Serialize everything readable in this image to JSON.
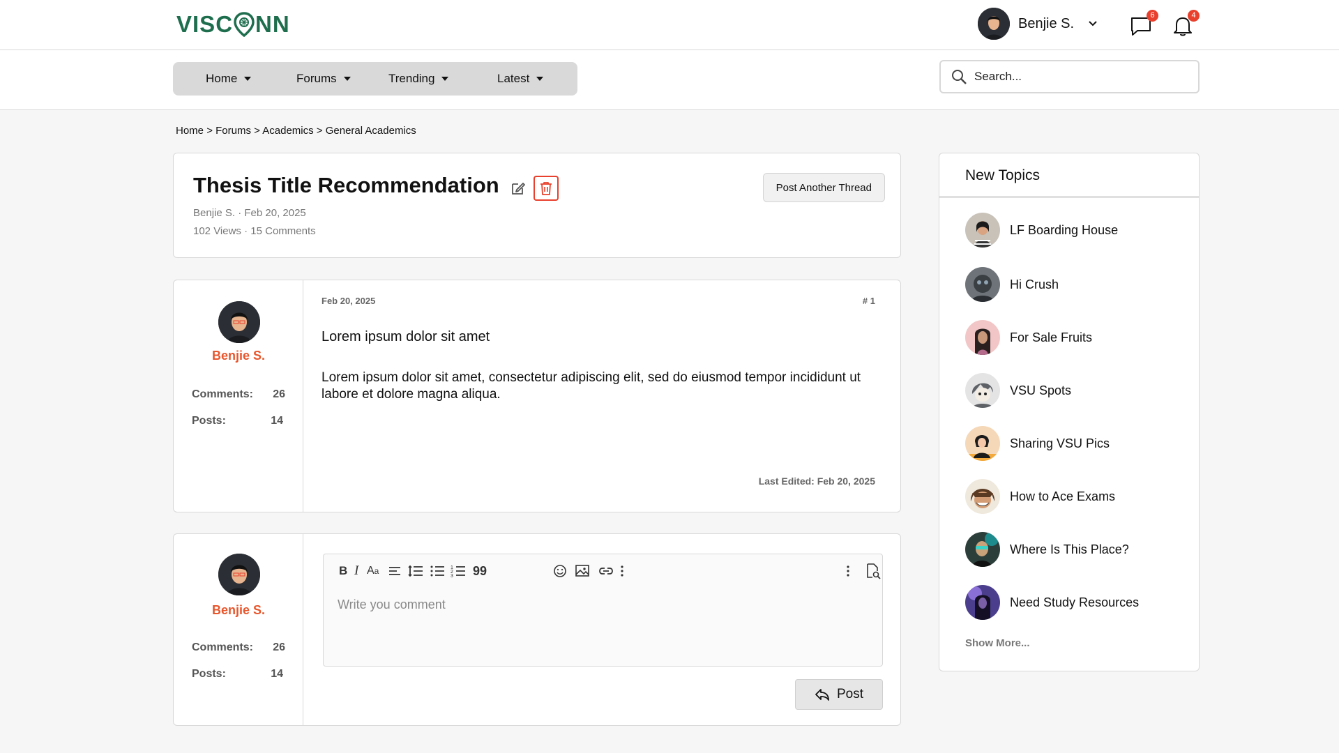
{
  "brand": {
    "logo_left": "VISC",
    "logo_right": "NN",
    "color": "#1e6e4e"
  },
  "header": {
    "user_name": "Benjie S.",
    "messages_count": "6",
    "notifications_count": "4"
  },
  "nav": {
    "items": [
      {
        "label": "Home"
      },
      {
        "label": "Forums"
      },
      {
        "label": "Trending"
      },
      {
        "label": "Latest"
      }
    ],
    "search_placeholder": "Search..."
  },
  "breadcrumb": {
    "items": [
      "Home",
      "Forums",
      "Academics",
      "General Academics"
    ],
    "separator": ">"
  },
  "thread": {
    "title": "Thesis Title Recommendation",
    "author_date": "Benjie S. · Feb 20, 2025",
    "stats": "102 Views · 15 Comments",
    "post_another_label": "Post Another Thread"
  },
  "post": {
    "author": "Benjie S.",
    "comments_label": "Comments:",
    "comments_value": "26",
    "posts_label": "Posts:",
    "posts_value": "14",
    "date": "Feb 20, 2025",
    "number": "# 1",
    "title": "Lorem ipsum dolor sit amet",
    "body": "Lorem ipsum dolor sit amet, consectetur adipiscing elit, sed do eiusmod tempor incididunt ut labore et dolore magna aliqua.",
    "last_edited": "Last Edited: Feb 20, 2025"
  },
  "reply": {
    "author": "Benjie S.",
    "comments_label": "Comments:",
    "comments_value": "26",
    "posts_label": "Posts:",
    "posts_value": "14",
    "comment_placeholder": "Write you comment",
    "post_label": "Post",
    "toolbar_icons": [
      "bold-icon",
      "italic-icon",
      "font-size-icon",
      "align-icon",
      "line-spacing-icon",
      "bullet-list-icon",
      "numbered-list-icon",
      "quote-icon",
      "emoji-icon",
      "image-icon",
      "link-icon",
      "more-icon",
      "more-vertical-icon",
      "preview-icon"
    ]
  },
  "sidebar": {
    "title": "New Topics",
    "topics": [
      {
        "label": "LF Boarding House",
        "color": "#c8c2b8"
      },
      {
        "label": "Hi Crush",
        "color": "#6d7378"
      },
      {
        "label": "For Sale Fruits",
        "color": "#f2c6c6"
      },
      {
        "label": "VSU Spots",
        "color": "#e4e4e4"
      },
      {
        "label": "Sharing VSU Pics",
        "color": "#f5d8b8"
      },
      {
        "label": "How to Ace Exams",
        "color": "#efe8dc"
      },
      {
        "label": "Where Is This Place?",
        "color": "#2c3e3a"
      },
      {
        "label": "Need Study Resources",
        "color": "#4b3e8c"
      }
    ],
    "show_more": "Show More..."
  },
  "colors": {
    "accent": "#e8562c",
    "danger": "#e8402c",
    "badge": "#e8402c"
  }
}
